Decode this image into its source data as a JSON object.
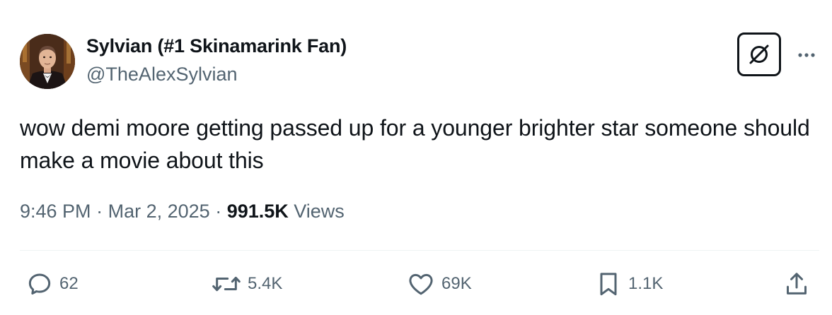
{
  "author": {
    "display_name": "Sylvian (#1 Skinamarink Fan)",
    "handle": "@TheAlexSylvian",
    "avatar_icon": "profile-photo-man-in-tuxedo"
  },
  "header_actions": {
    "grok_icon": "grok-icon",
    "more_icon": "more-horizontal-icon"
  },
  "tweet": {
    "text": "wow demi moore getting passed up for a younger brighter star someone should make a movie about this"
  },
  "meta": {
    "time": "9:46 PM",
    "separator": "·",
    "date": "Mar 2, 2025",
    "views_count": "991.5K",
    "views_label": "Views"
  },
  "actions": {
    "reply": {
      "icon": "reply-icon",
      "count": "62"
    },
    "repost": {
      "icon": "repost-icon",
      "count": "5.4K"
    },
    "like": {
      "icon": "heart-icon",
      "count": "69K"
    },
    "bookmark": {
      "icon": "bookmark-icon",
      "count": "1.1K"
    },
    "share": {
      "icon": "share-icon"
    }
  },
  "colors": {
    "text_primary": "#0f1419",
    "text_secondary": "#536471",
    "divider": "#eff3f4",
    "background": "#ffffff"
  }
}
